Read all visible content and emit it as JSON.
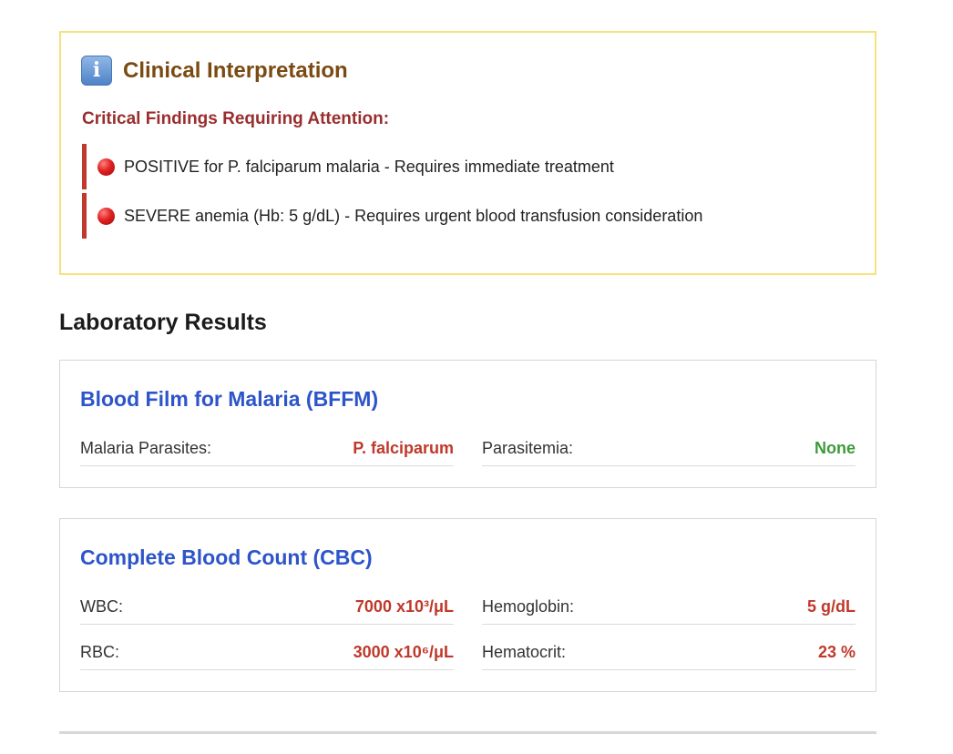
{
  "interpretation": {
    "icon": "info-icon",
    "icon_glyph": "i",
    "title": "Clinical Interpretation",
    "critical_heading": "Critical Findings Requiring Attention:",
    "findings": [
      "POSITIVE for P. falciparum malaria - Requires immediate treatment",
      "SEVERE anemia (Hb: 5 g/dL) - Requires urgent blood transfusion consideration"
    ]
  },
  "lab": {
    "heading": "Laboratory Results",
    "bffm": {
      "title": "Blood Film for Malaria (BFFM)",
      "rows": [
        {
          "label": "Malaria Parasites:",
          "value": "P. falciparum",
          "status": "abnormal"
        },
        {
          "label": "Parasitemia:",
          "value": "None",
          "status": "normal"
        }
      ]
    },
    "cbc": {
      "title": "Complete Blood Count (CBC)",
      "rows": [
        {
          "label": "WBC:",
          "value": "7000 x10³/μL",
          "status": "abnormal"
        },
        {
          "label": "Hemoglobin:",
          "value": "5 g/dL",
          "status": "abnormal"
        },
        {
          "label": "RBC:",
          "value": "3000 x10⁶/μL",
          "status": "abnormal"
        },
        {
          "label": "Hematocrit:",
          "value": "23 %",
          "status": "abnormal"
        }
      ]
    }
  },
  "colors": {
    "abnormal": "#c0392b",
    "normal": "#3e9a3a",
    "section_title": "#2d55c9",
    "interp_border": "#f5e27a",
    "interp_title": "#7a4a12",
    "critical_heading": "#992e2e"
  }
}
